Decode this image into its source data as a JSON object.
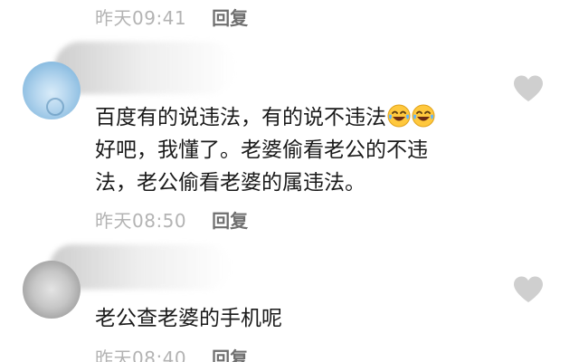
{
  "comments": [
    {
      "text_line1": "百度有的说违法，有的说不违法",
      "text_line2": "好吧，我懂了。老婆偷看老公的不违",
      "text_line3": "法，老公偷看老婆的属违法。",
      "emojis": [
        "laugh-cry-emoji",
        "laugh-cry-emoji"
      ],
      "time": "昨天08:50",
      "reply": "回复"
    },
    {
      "text": "老公查老婆的手机呢",
      "time": "昨天08:40",
      "reply": "回复"
    }
  ],
  "previous_comment": {
    "time": "昨天09:41",
    "reply": "回复"
  },
  "icons": {
    "like": "heart-icon",
    "emoji": "laugh-cry-emoji"
  },
  "colors": {
    "background": "#ffffff",
    "meta_text": "#b3b3b3",
    "reply_text": "#6f6f6f",
    "body_text": "#1a1a1a",
    "heart": "#cfcfcf",
    "emoji_face": "#ffc83d"
  }
}
